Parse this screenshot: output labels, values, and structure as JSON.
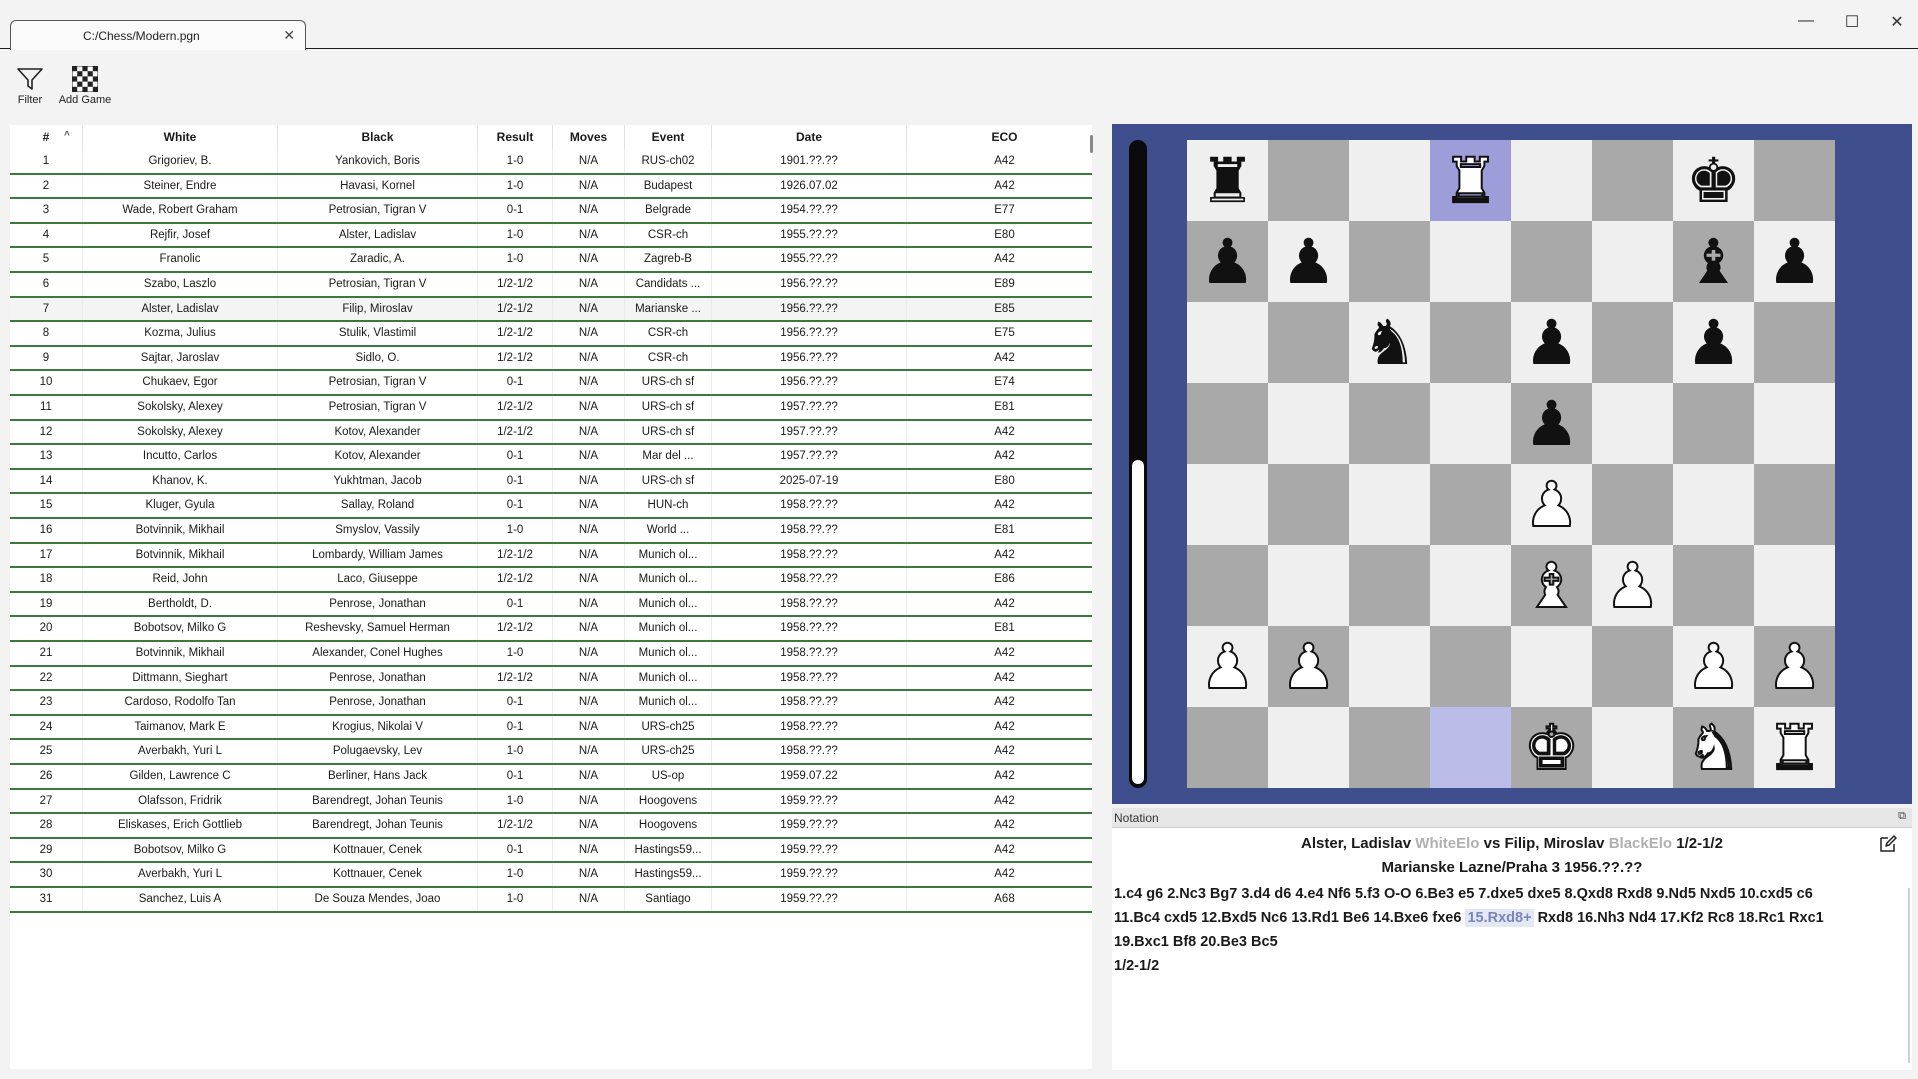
{
  "tab": {
    "title": "C:/Chess/Modern.pgn",
    "close": "✕"
  },
  "window": {
    "minimize": "—",
    "maximize": "☐",
    "close": "✕"
  },
  "toolbar": {
    "filter_label": "Filter",
    "add_game_label": "Add Game"
  },
  "table": {
    "sort_indicator": "^",
    "headers": {
      "num": "#",
      "white": "White",
      "black": "Black",
      "result": "Result",
      "moves": "Moves",
      "event": "Event",
      "date": "Date",
      "eco": "ECO"
    },
    "rows": [
      [
        "1",
        "Grigoriev, B.",
        "Yankovich, Boris",
        "1-0",
        "N/A",
        "RUS-ch02",
        "1901.??.??",
        "A42"
      ],
      [
        "2",
        "Steiner, Endre",
        "Havasi, Kornel",
        "1-0",
        "N/A",
        "Budapest",
        "1926.07.02",
        "A42"
      ],
      [
        "3",
        "Wade, Robert Graham",
        "Petrosian, Tigran V",
        "0-1",
        "N/A",
        "Belgrade",
        "1954.??.??",
        "E77"
      ],
      [
        "4",
        "Rejfir, Josef",
        "Alster, Ladislav",
        "1-0",
        "N/A",
        "CSR-ch",
        "1955.??.??",
        "E80"
      ],
      [
        "5",
        "Franolic",
        "Zaradic, A.",
        "1-0",
        "N/A",
        "Zagreb-B",
        "1955.??.??",
        "A42"
      ],
      [
        "6",
        "Szabo, Laszlo",
        "Petrosian, Tigran V",
        "1/2-1/2",
        "N/A",
        "Candidats ...",
        "1956.??.??",
        "E89"
      ],
      [
        "7",
        "Alster, Ladislav",
        "Filip, Miroslav",
        "1/2-1/2",
        "N/A",
        "Marianske ...",
        "1956.??.??",
        "E85"
      ],
      [
        "8",
        "Kozma, Julius",
        "Stulik, Vlastimil",
        "1/2-1/2",
        "N/A",
        "CSR-ch",
        "1956.??.??",
        "E75"
      ],
      [
        "9",
        "Sajtar, Jaroslav",
        "Sidlo, O.",
        "1/2-1/2",
        "N/A",
        "CSR-ch",
        "1956.??.??",
        "A42"
      ],
      [
        "10",
        "Chukaev, Egor",
        "Petrosian, Tigran V",
        "0-1",
        "N/A",
        "URS-ch sf",
        "1956.??.??",
        "E74"
      ],
      [
        "11",
        "Sokolsky, Alexey",
        "Petrosian, Tigran V",
        "1/2-1/2",
        "N/A",
        "URS-ch sf",
        "1957.??.??",
        "E81"
      ],
      [
        "12",
        "Sokolsky, Alexey",
        "Kotov, Alexander",
        "1/2-1/2",
        "N/A",
        "URS-ch sf",
        "1957.??.??",
        "A42"
      ],
      [
        "13",
        "Incutto, Carlos",
        "Kotov, Alexander",
        "0-1",
        "N/A",
        "Mar del ...",
        "1957.??.??",
        "A42"
      ],
      [
        "14",
        "Khanov, K.",
        "Yukhtman, Jacob",
        "0-1",
        "N/A",
        "URS-ch sf",
        "2025-07-19",
        "E80"
      ],
      [
        "15",
        "Kluger, Gyula",
        "Sallay, Roland",
        "0-1",
        "N/A",
        "HUN-ch",
        "1958.??.??",
        "A42"
      ],
      [
        "16",
        "Botvinnik, Mikhail",
        "Smyslov, Vassily",
        "1-0",
        "N/A",
        "World ...",
        "1958.??.??",
        "E81"
      ],
      [
        "17",
        "Botvinnik, Mikhail",
        "Lombardy, William James",
        "1/2-1/2",
        "N/A",
        "Munich ol...",
        "1958.??.??",
        "A42"
      ],
      [
        "18",
        "Reid, John",
        "Laco, Giuseppe",
        "1/2-1/2",
        "N/A",
        "Munich ol...",
        "1958.??.??",
        "E86"
      ],
      [
        "19",
        "Bertholdt, D.",
        "Penrose, Jonathan",
        "0-1",
        "N/A",
        "Munich ol...",
        "1958.??.??",
        "A42"
      ],
      [
        "20",
        "Bobotsov, Milko G",
        "Reshevsky, Samuel Herman",
        "1/2-1/2",
        "N/A",
        "Munich ol...",
        "1958.??.??",
        "E81"
      ],
      [
        "21",
        "Botvinnik, Mikhail",
        "Alexander, Conel Hughes",
        "1-0",
        "N/A",
        "Munich ol...",
        "1958.??.??",
        "A42"
      ],
      [
        "22",
        "Dittmann, Sieghart",
        "Penrose, Jonathan",
        "1/2-1/2",
        "N/A",
        "Munich ol...",
        "1958.??.??",
        "A42"
      ],
      [
        "23",
        "Cardoso, Rodolfo Tan",
        "Penrose, Jonathan",
        "0-1",
        "N/A",
        "Munich ol...",
        "1958.??.??",
        "A42"
      ],
      [
        "24",
        "Taimanov, Mark E",
        "Krogius, Nikolai V",
        "0-1",
        "N/A",
        "URS-ch25",
        "1958.??.??",
        "A42"
      ],
      [
        "25",
        "Averbakh, Yuri L",
        "Polugaevsky, Lev",
        "1-0",
        "N/A",
        "URS-ch25",
        "1958.??.??",
        "A42"
      ],
      [
        "26",
        "Gilden, Lawrence C",
        "Berliner, Hans Jack",
        "0-1",
        "N/A",
        "US-op",
        "1959.07.22",
        "A42"
      ],
      [
        "27",
        "Olafsson, Fridrik",
        "Barendregt, Johan Teunis",
        "1-0",
        "N/A",
        "Hoogovens",
        "1959.??.??",
        "A42"
      ],
      [
        "28",
        "Eliskases, Erich Gottlieb",
        "Barendregt, Johan Teunis",
        "1/2-1/2",
        "N/A",
        "Hoogovens",
        "1959.??.??",
        "A42"
      ],
      [
        "29",
        "Bobotsov, Milko G",
        "Kottnauer, Cenek",
        "0-1",
        "N/A",
        "Hastings59...",
        "1959.??.??",
        "A42"
      ],
      [
        "30",
        "Averbakh, Yuri L",
        "Kottnauer, Cenek",
        "1-0",
        "N/A",
        "Hastings59...",
        "1959.??.??",
        "A42"
      ],
      [
        "31",
        "Sanchez, Luis A",
        "De Souza Mendes, Joao",
        "1-0",
        "N/A",
        "Santiago",
        "1959.??.??",
        "A68"
      ]
    ],
    "selected_row": 7
  },
  "board": {
    "eval_white_fraction": 0.5,
    "position": [
      [
        "r",
        "",
        "",
        "R",
        "",
        "",
        "k",
        ""
      ],
      [
        "p",
        "p",
        "",
        "",
        "",
        "",
        "b",
        "p"
      ],
      [
        "",
        "",
        "n",
        "",
        "p",
        "",
        "p",
        ""
      ],
      [
        "",
        "",
        "",
        "",
        "p",
        "",
        "",
        ""
      ],
      [
        "",
        "",
        "",
        "",
        "P",
        "",
        "",
        ""
      ],
      [
        "",
        "",
        "",
        "",
        "B",
        "P",
        "",
        ""
      ],
      [
        "P",
        "P",
        "",
        "",
        "",
        "",
        "P",
        "P"
      ],
      [
        "",
        "",
        "",
        "",
        "K",
        "",
        "N",
        "R"
      ]
    ],
    "highlights": [
      [
        0,
        3
      ],
      [
        7,
        3
      ]
    ],
    "colors": {
      "panel": "#3f4f8d",
      "light": "#efefef",
      "dark": "#a9a9a9",
      "highlight": "#bcbce8"
    }
  },
  "notation": {
    "panel_title": "Notation",
    "undock": "⧉",
    "white_player": "Alster, Ladislav",
    "white_elo": "WhiteElo",
    "vs": "vs",
    "black_player": "Filip, Miroslav",
    "black_elo": "BlackElo",
    "result": "1/2-1/2",
    "event_line": "Marianske Lazne/Praha  3  1956.??.??",
    "moves_line1": "1.c4 g6 2.Nc3 Bg7 3.d4 d6 4.e4 Nf6 5.f3 O-O 6.Be3 e5 7.dxe5 dxe5 8.Qxd8 Rxd8 9.Nd5 Nxd5 10.cxd5 c6",
    "moves_line2_pre": "11.Bc4 cxd5 12.Bxd5 Nc6 13.Rd1 Be6 14.Bxe6 fxe6",
    "current_move": "15.Rxd8+",
    "moves_line2_post": "Rxd8 16.Nh3 Nd4 17.Kf2 Rc8 18.Rc1 Rxc1",
    "moves_line3": "19.Bxc1 Bf8 20.Be3 Bc5",
    "final_result": "1/2-1/2"
  }
}
